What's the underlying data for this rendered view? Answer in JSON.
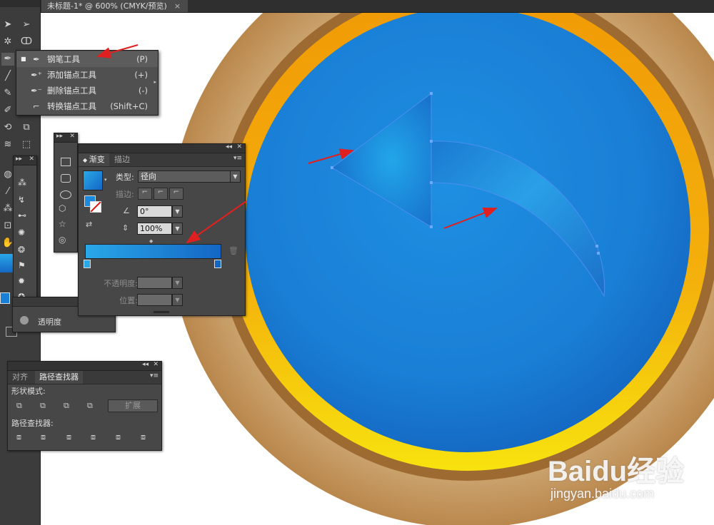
{
  "document_tab": {
    "title": "未标题-1* @ 600% (CMYK/预览)",
    "close": "×"
  },
  "toolbar": {
    "tools": [
      "selection-tool",
      "direct-selection-tool",
      "magic-wand-tool",
      "lasso-tool",
      "pen-tool",
      "line-tool",
      "paintbrush-tool",
      "blob-brush-tool",
      "rotate-tool",
      "scale-tool",
      "width-tool",
      "free-transform-tool",
      "shape-builder-tool",
      "perspective-tool",
      "eyedropper-tool",
      "symbol-sprayer-tool",
      "artboard-tool",
      "slice-tool",
      "hand-tool",
      "zoom-tool"
    ]
  },
  "pen_flyout": {
    "items": [
      {
        "label": "钢笔工具",
        "shortcut": "(P)",
        "icon": "pen-icon",
        "selected": true
      },
      {
        "label": "添加锚点工具",
        "shortcut": "(+)",
        "icon": "add-anchor-icon",
        "selected": false
      },
      {
        "label": "删除锚点工具",
        "shortcut": "(-)",
        "icon": "delete-anchor-icon",
        "selected": false
      },
      {
        "label": "转换锚点工具",
        "shortcut": "(Shift+C)",
        "icon": "convert-anchor-icon",
        "selected": false
      }
    ]
  },
  "gradient_panel": {
    "tabs": [
      "渐变",
      "描边"
    ],
    "type_label": "类型:",
    "type_value": "径向",
    "stroke_label": "描边:",
    "angle_value": "0°",
    "aspect_value": "100%",
    "opacity_label": "不透明度:",
    "position_label": "位置:",
    "colors": {
      "start": "#29a8e8",
      "end": "#1466c4"
    }
  },
  "transparency_panel": {
    "label": "透明度"
  },
  "pathfinder_panel": {
    "tabs": [
      "对齐",
      "路径查找器"
    ],
    "shape_modes_label": "形状模式:",
    "expand_label": "扩展",
    "pathfinders_label": "路径查找器:"
  },
  "watermark": {
    "brand": "Baidu经验",
    "url": "jingyan.baidu.com"
  },
  "colors": {
    "accent_arrow": "#e02020",
    "ring_gold": "#f2a30b",
    "ring_brown": "#b8864e",
    "disc_blue": "#1c82d8"
  }
}
